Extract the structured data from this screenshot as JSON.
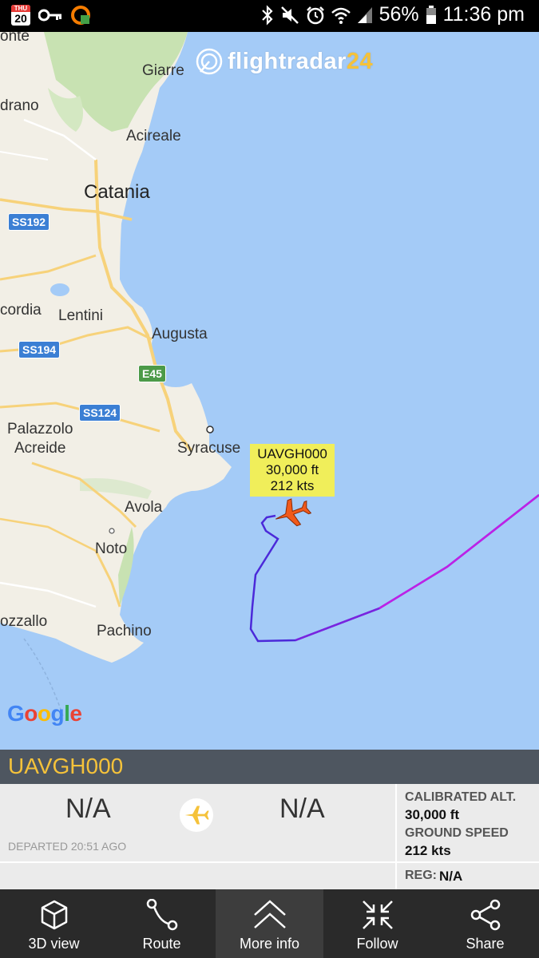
{
  "status_bar": {
    "calendar_day": "THU",
    "calendar_date": "20",
    "battery": "56%",
    "time": "11:36 pm",
    "icons": [
      "calendar-icon",
      "key-icon",
      "app-icon",
      "bluetooth-icon",
      "mute-icon",
      "alarm-icon",
      "wifi-icon",
      "signal-icon",
      "battery-icon"
    ]
  },
  "map": {
    "brand": "flightradar",
    "brand_suffix": "24",
    "places": [
      "onte",
      "Giarre",
      "drano",
      "Acireale",
      "Catania",
      "Lentini",
      "cordia",
      "Augusta",
      "Palazzolo",
      "Acreide",
      "Syracuse",
      "Avola",
      "Noto",
      "ozzallo",
      "Pachino"
    ],
    "roads": [
      "SS192",
      "SS194",
      "E45",
      "SS124"
    ],
    "flight_label": {
      "callsign": "UAVGH000",
      "altitude": "30,000 ft",
      "speed": "212 kts"
    },
    "attribution": "Google"
  },
  "panel": {
    "callsign": "UAVGH000",
    "origin": "N/A",
    "destination": "N/A",
    "departed": "DEPARTED 20:51 AGO",
    "calibrated_alt_label": "CALIBRATED ALT.",
    "calibrated_alt_value": "30,000 ft",
    "ground_speed_label": "GROUND SPEED",
    "ground_speed_value": "212 kts",
    "reg_label": "REG:",
    "reg_value": "N/A"
  },
  "nav": {
    "items": [
      {
        "label": "3D view",
        "icon": "cube-icon"
      },
      {
        "label": "Route",
        "icon": "route-icon"
      },
      {
        "label": "More info",
        "icon": "chevron-up-icon"
      },
      {
        "label": "Follow",
        "icon": "follow-icon"
      },
      {
        "label": "Share",
        "icon": "share-icon"
      }
    ]
  },
  "colors": {
    "accent": "#f5c23a",
    "track_start": "#3b2fd6",
    "track_end": "#c81ee8",
    "plane": "#f05a1c"
  }
}
